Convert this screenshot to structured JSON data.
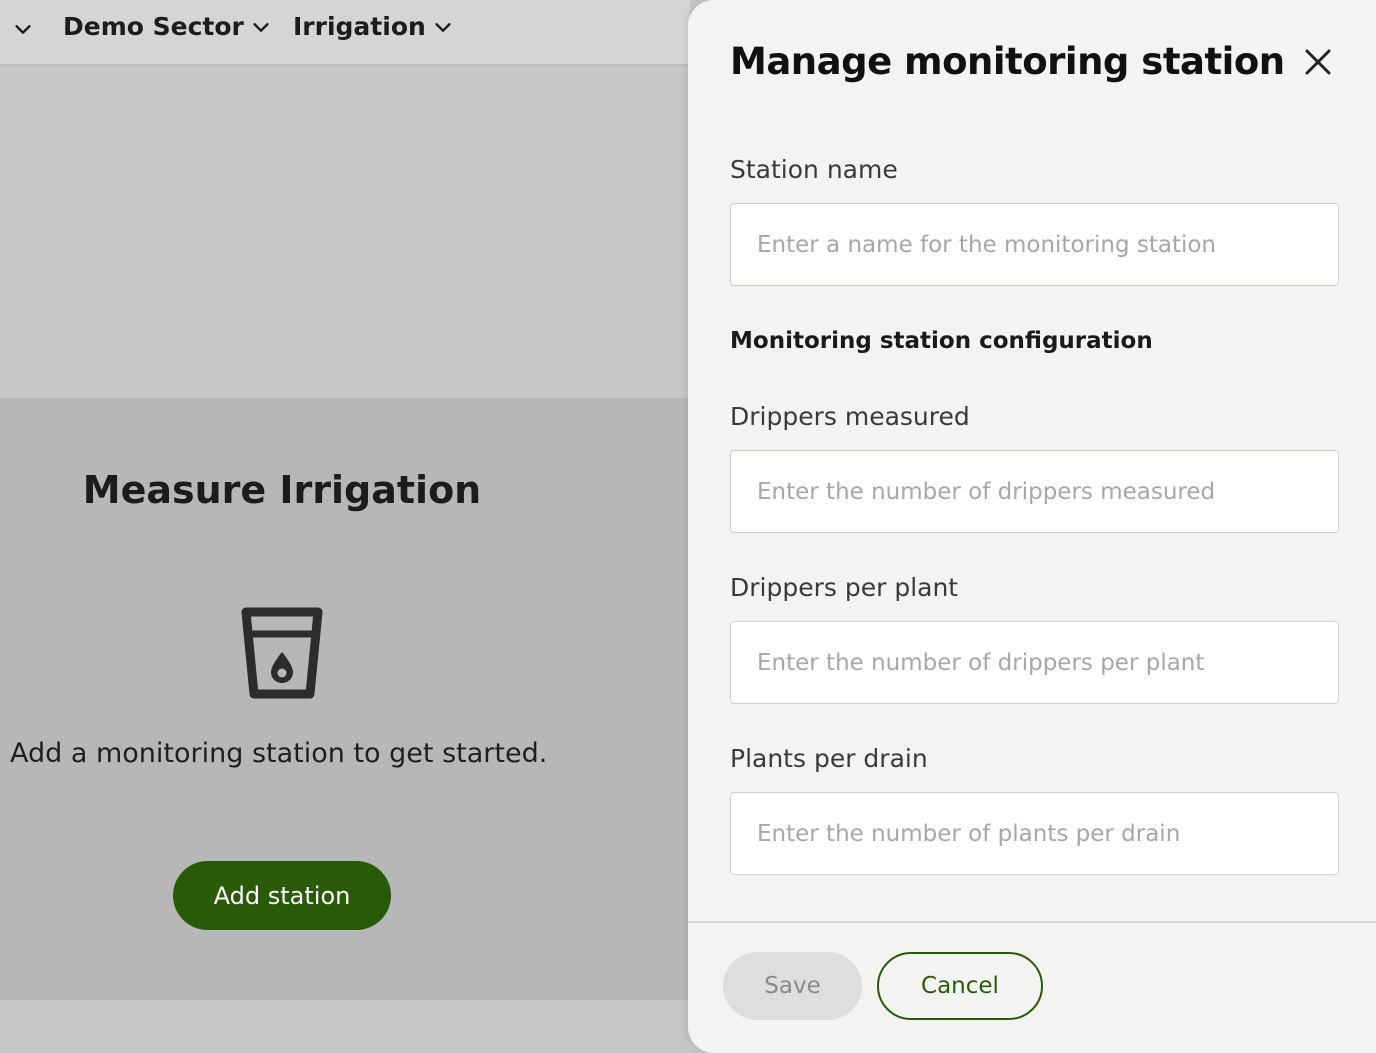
{
  "topbar": {
    "sector_label": "Demo Sector",
    "irrigation_label": "Irrigation"
  },
  "card": {
    "title": "Measure Irrigation",
    "subtitle": "Add a monitoring station to get started.",
    "add_button": "Add station"
  },
  "panel": {
    "title": "Manage monitoring station",
    "station_name": {
      "label": "Station name",
      "placeholder": "Enter a name for the monitoring station",
      "value": ""
    },
    "config_title": "Monitoring station configuration",
    "drippers_measured": {
      "label": "Drippers measured",
      "placeholder": "Enter the number of drippers measured",
      "value": ""
    },
    "drippers_per_plant": {
      "label": "Drippers per plant",
      "placeholder": "Enter the number of drippers per plant",
      "value": ""
    },
    "plants_per_drain": {
      "label": "Plants per drain",
      "placeholder": "Enter the number of plants per drain",
      "value": ""
    },
    "save_label": "Save",
    "cancel_label": "Cancel"
  },
  "icons": {
    "nav_chevron": "chevron-down-icon",
    "card_icon": "water-glass-icon",
    "close": "close-icon"
  },
  "colors": {
    "primary": "#285a07",
    "panel_bg": "#f3f4f2",
    "overlay_bg": "#c6c6c6",
    "card_bg": "#b7b7b7",
    "disabled_button_bg": "#dedede"
  }
}
